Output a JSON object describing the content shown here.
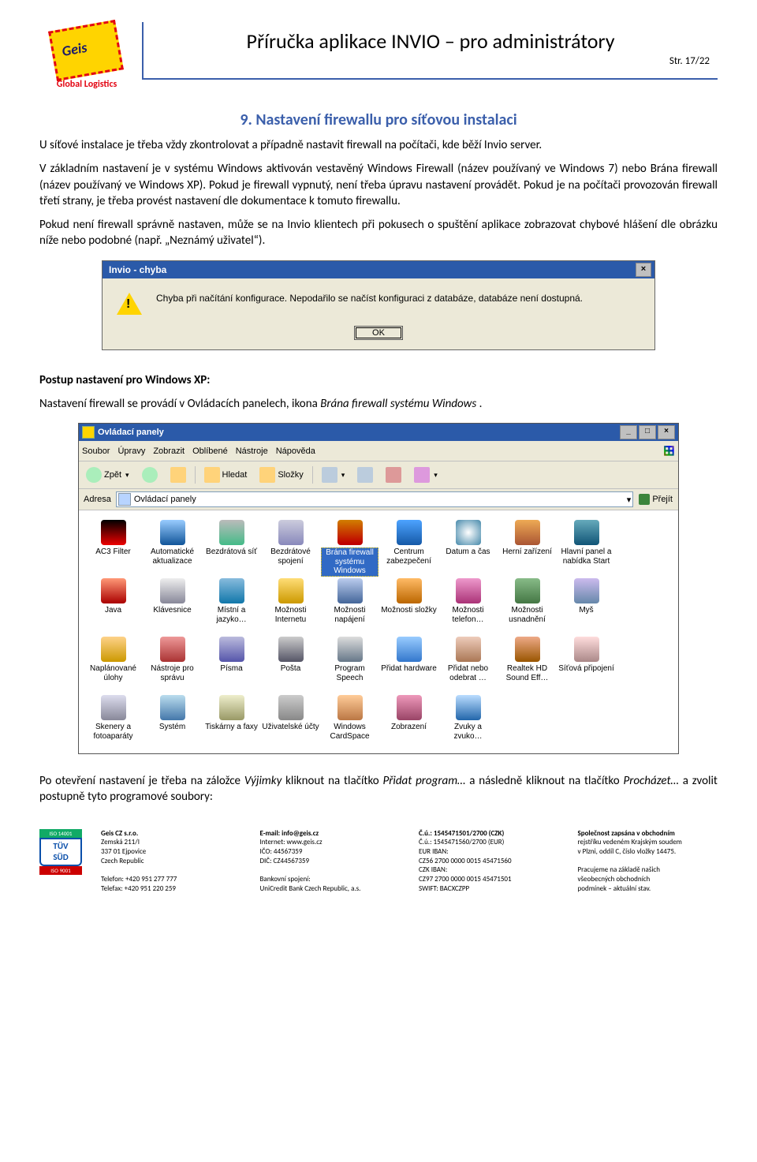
{
  "header": {
    "logo_text": "Geis",
    "logo_sub": "Global Logistics",
    "title": "Příručka aplikace INVIO – pro administrátory",
    "page": "Str. 17/22"
  },
  "section": {
    "heading": "9. Nastavení firewallu pro síťovou instalaci",
    "p1": "U síťové instalace je třeba vždy zkontrolovat a případně nastavit firewall na počítači, kde běží Invio server.",
    "p2": "V základním nastavení je v systému Windows aktivován vestavěný Windows Firewall (název používaný ve Windows 7) nebo Brána firewall (název používaný ve Windows XP). Pokud je firewall vypnutý, není třeba úpravu nastavení provádět. Pokud je na počítači provozován firewall třetí strany, je třeba provést nastavení dle dokumentace k tomuto firewallu.",
    "p3": "Pokud není firewall správně nastaven, může se na Invio klientech při pokusech o spuštění aplikace zobrazovat chybové hlášení dle obrázku níže nebo podobné (např. „Neznámý uživatel“)."
  },
  "dialog": {
    "title": "Invio - chyba",
    "message": "Chyba při načítání konfigurace. Nepodařilo se načíst konfiguraci z databáze, databáze není dostupná.",
    "ok": "OK"
  },
  "postup": {
    "heading": "Postup nastavení pro Windows XP:",
    "line1a": "Nastavení firewall se provádí v Ovládacích panelech, ikona ",
    "line1b": "Brána firewall systému Windows",
    "line1c": "."
  },
  "cp": {
    "title": "Ovládací panely",
    "menu": [
      "Soubor",
      "Úpravy",
      "Zobrazit",
      "Oblíbené",
      "Nástroje",
      "Nápověda"
    ],
    "tb": {
      "back": "Zpět",
      "search": "Hledat",
      "folders": "Složky"
    },
    "addr_label": "Adresa",
    "addr_value": "Ovládací panely",
    "go": "Přejít",
    "items": [
      {
        "label": "AC3 Filter",
        "c": "c1"
      },
      {
        "label": "Automatické aktualizace",
        "c": "c2"
      },
      {
        "label": "Bezdrátová síť",
        "c": "c3"
      },
      {
        "label": "Bezdrátové spojení",
        "c": "c4"
      },
      {
        "label": "Brána firewall systému Windows",
        "c": "c5",
        "selected": true
      },
      {
        "label": "Centrum zabezpečení",
        "c": "c6"
      },
      {
        "label": "Datum a čas",
        "c": "c7"
      },
      {
        "label": "Herní zařízení",
        "c": "c8"
      },
      {
        "label": "Hlavní panel a nabídka Start",
        "c": "c9"
      },
      {
        "label": "Java",
        "c": "c10"
      },
      {
        "label": "Klávesnice",
        "c": "c11"
      },
      {
        "label": "Místní a jazyko…",
        "c": "c12"
      },
      {
        "label": "Možnosti Internetu",
        "c": "c13"
      },
      {
        "label": "Možnosti napájení",
        "c": "c14"
      },
      {
        "label": "Možnosti složky",
        "c": "c15"
      },
      {
        "label": "Možnosti telefon…",
        "c": "c16"
      },
      {
        "label": "Možnosti usnadnění",
        "c": "c17"
      },
      {
        "label": "Myš",
        "c": "c18"
      },
      {
        "label": "Naplánované úlohy",
        "c": "c19"
      },
      {
        "label": "Nástroje pro správu",
        "c": "c20"
      },
      {
        "label": "Písma",
        "c": "c21"
      },
      {
        "label": "Pošta",
        "c": "c22"
      },
      {
        "label": "Program Speech",
        "c": "c23"
      },
      {
        "label": "Přidat hardware",
        "c": "c24"
      },
      {
        "label": "Přidat nebo odebrat …",
        "c": "c25"
      },
      {
        "label": "Realtek HD Sound Eff…",
        "c": "c26"
      },
      {
        "label": "Síťová připojení",
        "c": "c27"
      },
      {
        "label": "Skenery a fotoaparáty",
        "c": "c28"
      },
      {
        "label": "Systém",
        "c": "c29"
      },
      {
        "label": "Tiskárny a faxy",
        "c": "c30"
      },
      {
        "label": "Uživatelské účty",
        "c": "c31"
      },
      {
        "label": "Windows CardSpace",
        "c": "c32"
      },
      {
        "label": "Zobrazení",
        "c": "c33"
      },
      {
        "label": "Zvuky a zvuko…",
        "c": "c34"
      }
    ]
  },
  "closing": {
    "a": "Po otevření nastavení je třeba na záložce ",
    "b": "Výjimky",
    "c": " kliknout na tlačítko ",
    "d": "Přidat program…",
    "e": " a následně kliknout na tlačítko ",
    "f": "Procházet…",
    "g": " a zvolit postupně tyto programové soubory:"
  },
  "footer": {
    "tuv_top": "ISO 14001",
    "tuv_mid_top": "TÜV",
    "tuv_mid_bot": "SÜD",
    "tuv_bottom": "ISO 9001",
    "col1": [
      "Geis CZ s.r.o.",
      "Zemská 211/I",
      "337 01 Ejpovice",
      "Czech Republic",
      "",
      "Telefon: +420 951 277 777",
      "Telefax: +420 951 220 259"
    ],
    "col2": [
      "E-mail: info@geis.cz",
      "Internet: www.geis.cz",
      "IČO: 44567359",
      "DIČ: CZ44567359",
      "",
      "Bankovní spojení:",
      "UniCredit Bank Czech Republic, a.s."
    ],
    "col3": [
      "Č.ú.: 1545471501/2700 (CZK)",
      "Č.ú.: 1545471560/2700 (EUR)",
      "EUR IBAN:",
      "CZ56 2700 0000 0015 45471560",
      "CZK IBAN:",
      "CZ97 2700 0000 0015 45471501",
      "SWIFT: BACXCZPP"
    ],
    "col4": [
      "Společnost zapsána v obchodním",
      "rejstříku vedeném Krajským soudem",
      "v Plzni, oddíl C, číslo vložky 14475.",
      "",
      "Pracujeme na základě našich",
      "všeobecných obchodních",
      "podmínek – aktuální stav."
    ]
  }
}
